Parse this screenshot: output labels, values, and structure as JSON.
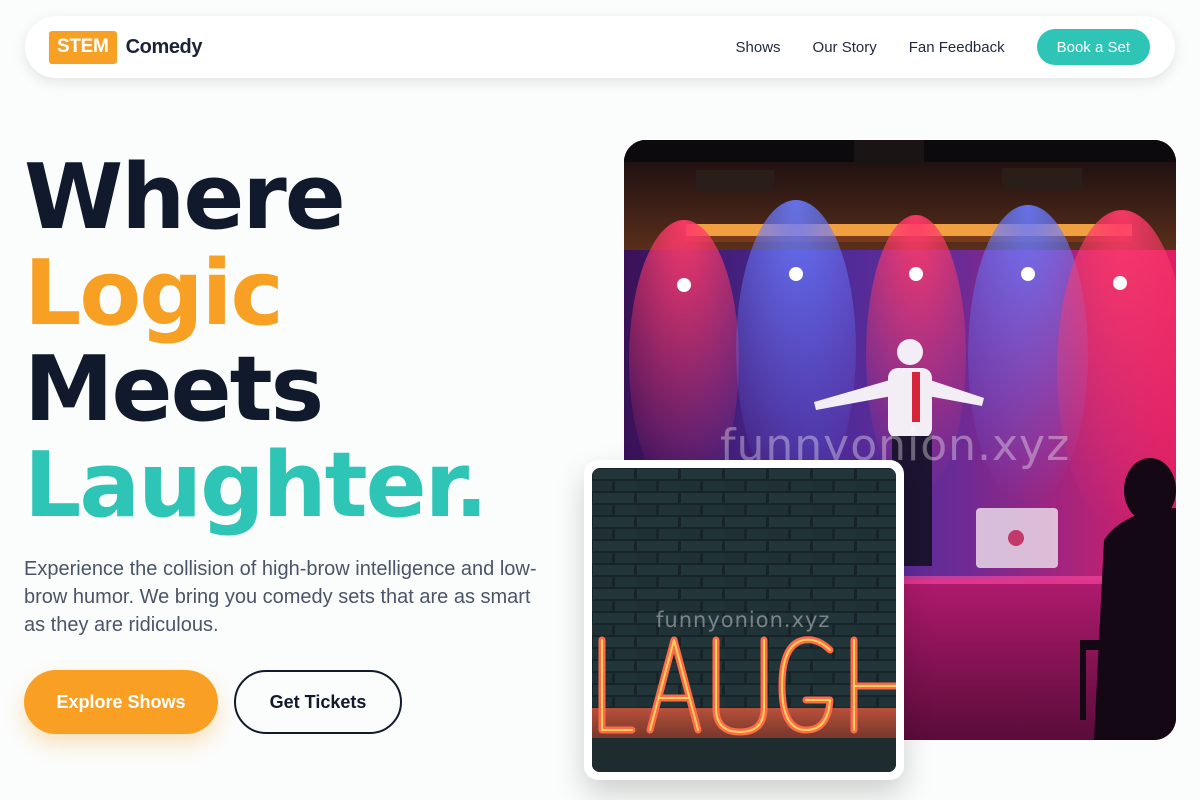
{
  "nav": {
    "logo_badge": "STEM",
    "logo_word": "Comedy",
    "links": [
      "Shows",
      "Our Story",
      "Fan Feedback"
    ],
    "cta": "Book a Set"
  },
  "hero": {
    "title_words": [
      "Where",
      "Logic",
      "Meets",
      "Laughter."
    ],
    "subtitle": "Experience the collision of high-brow intelligence and low-brow humor. We bring you comedy sets that are as smart as they are ridiculous.",
    "primary_button": "Explore Shows",
    "secondary_button": "Get Tickets"
  },
  "images": {
    "stage_watermark": "funnyonion.xyz",
    "sign_watermark": "funnyonion.xyz",
    "sign_text": "LAUGH"
  },
  "colors": {
    "accent_orange": "#f7a024",
    "accent_teal": "#2ec4b6",
    "ink": "#111a2c"
  }
}
